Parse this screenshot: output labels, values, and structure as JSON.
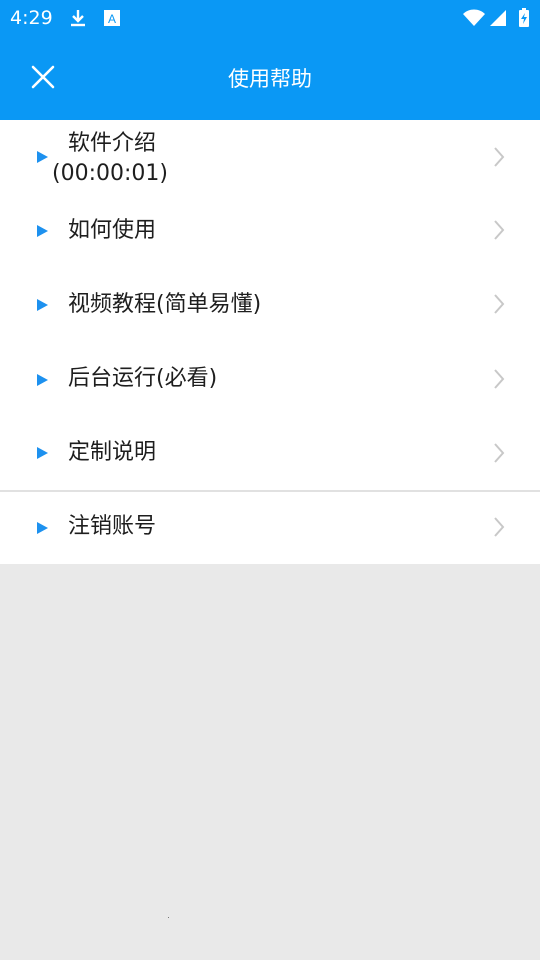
{
  "status_bar": {
    "time": "4:29",
    "icons": [
      "download-icon",
      "a-icon",
      "wifi-icon",
      "signal-icon",
      "battery-icon"
    ]
  },
  "header": {
    "title": "使用帮助",
    "close_icon": "close-icon",
    "accent_color": "#0a98f5"
  },
  "menu": {
    "items": [
      {
        "label": "软件介绍",
        "sublabel": "(00:00:01)"
      },
      {
        "label": "如何使用"
      },
      {
        "label": "视频教程(简单易懂)"
      },
      {
        "label": "后台运行(必看)"
      },
      {
        "label": "定制说明"
      },
      {
        "label": "注销账号"
      }
    ]
  }
}
